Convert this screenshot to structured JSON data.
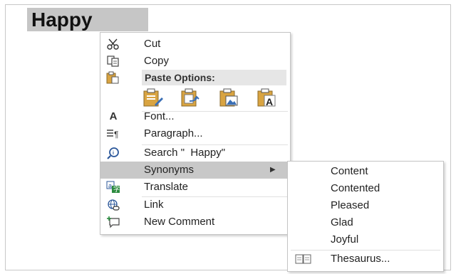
{
  "document": {
    "selected_word": "Happy"
  },
  "context_menu": {
    "cut": {
      "label": "Cut",
      "icon": "scissors-icon"
    },
    "copy": {
      "label": "Copy",
      "icon": "copy-icon"
    },
    "paste_options": {
      "header": "Paste Options:",
      "icon": "clipboard-icon",
      "buttons": [
        {
          "name": "keep-source-formatting-icon"
        },
        {
          "name": "merge-formatting-icon"
        },
        {
          "name": "picture-icon"
        },
        {
          "name": "keep-text-only-icon"
        }
      ]
    },
    "font": {
      "label": "Font...",
      "icon": "font-icon"
    },
    "paragraph": {
      "label": "Paragraph...",
      "icon": "paragraph-icon"
    },
    "search": {
      "label": "Search \"  Happy\"",
      "icon": "search-icon"
    },
    "synonyms": {
      "label": "Synonyms",
      "icon": "",
      "has_submenu": true
    },
    "translate": {
      "label": "Translate",
      "icon": "translate-icon"
    },
    "link": {
      "label": "Link",
      "icon": "link-icon"
    },
    "new_comment": {
      "label": "New Comment",
      "icon": "new-comment-icon"
    }
  },
  "synonyms_submenu": {
    "items": [
      "Content",
      "Contented",
      "Pleased",
      "Glad",
      "Joyful"
    ],
    "thesaurus": {
      "label": "Thesaurus...",
      "icon": "thesaurus-icon"
    }
  },
  "colors": {
    "highlight": "#c8c8c8",
    "selection": "#c6c6c6",
    "paste_icon_accent": "#d9a441",
    "translate_accent": "#2a8a3e"
  }
}
